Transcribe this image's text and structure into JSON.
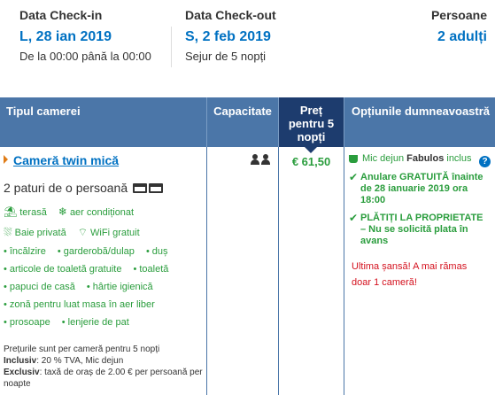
{
  "summary": {
    "checkin_label": "Data Check-in",
    "checkin_date": "L, 28 ian 2019",
    "checkin_sub": "De la 00:00 până la 00:00",
    "checkout_label": "Data Check-out",
    "checkout_date": "S, 2 feb 2019",
    "checkout_sub": "Sejur de 5 nopți",
    "guests_label": "Persoane",
    "guests_value": "2 adulți"
  },
  "table": {
    "headers": {
      "room_type": "Tipul camerei",
      "capacity": "Capacitate",
      "price_line1": "Preț",
      "price_line2": "pentru 5",
      "price_line3": "nopți",
      "options": "Opțiunile dumneavoastră"
    },
    "room": {
      "title": "Cameră twin mică",
      "beds": "2 paturi de o persoană",
      "facilities_row1": [
        "terasă",
        "aer condiționat"
      ],
      "facilities_row2": [
        "Baie privată",
        "WiFi gratuit"
      ],
      "amenities": [
        [
          "încălzire",
          "garderobă/dulap",
          "duș"
        ],
        [
          "articole de toaletă gratuite",
          "toaletă"
        ],
        [
          "papuci de casă",
          "hârtie igienică"
        ],
        [
          "zonă pentru luat masa în aer liber"
        ],
        [
          "prosoape",
          "lenjerie de pat"
        ]
      ],
      "note_line1": "Prețurile sunt per cameră pentru 5 nopți",
      "note_inclusive_label": "Inclusiv",
      "note_inclusive_text": ": 20 % TVA, Mic dejun",
      "note_exclusive_label": "Exclusiv",
      "note_exclusive_text": ": taxă de oraș de 2.00 € per persoană per noapte"
    },
    "capacity_persons": 2,
    "price": "€ 61,50",
    "options": {
      "breakfast_prefix": "Mic dejun",
      "breakfast_name": "Fabulos",
      "breakfast_suffix": "inclus",
      "help_icon": "?",
      "cancel": "Anulare GRATUITĂ înainte de 28 ianuarie 2019 ora 18:00",
      "pay": "PLĂTIȚI LA PROPRIETATE – Nu se solicită plata în avans",
      "warning": "Ultima șansă! A mai rămas doar 1 cameră!"
    }
  },
  "colors": {
    "brand_blue": "#0071c2",
    "header_bg": "#4b76a8",
    "price_header_bg": "#1d3c6e",
    "green": "#2a9d3d",
    "red": "#d4111e"
  }
}
